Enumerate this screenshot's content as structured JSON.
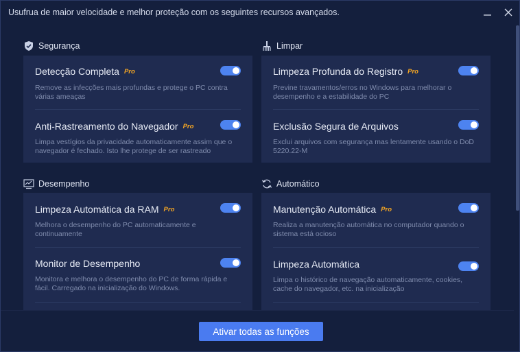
{
  "window": {
    "title": "Usufrua de maior velocidade e melhor proteção com os seguintes recursos avançados."
  },
  "sections": {
    "security": {
      "label": "Segurança",
      "icon": "shield-check-icon",
      "features": [
        {
          "title": "Detecção Completa",
          "pro": "Pro",
          "desc1": "Remove as infecções mais profundas e protege o PC contra",
          "desc2": "várias ameaças",
          "enabled": true
        },
        {
          "title": "Anti-Rastreamento do Navegador",
          "pro": "Pro",
          "desc1": "Limpa vestígios da privacidade automaticamente assim que o",
          "desc2": "navegador é fechado. Isto lhe protege de ser rastreado",
          "enabled": true
        }
      ]
    },
    "clean": {
      "label": "Limpar",
      "icon": "broom-icon",
      "features": [
        {
          "title": "Limpeza Profunda do Registro",
          "pro": "Pro",
          "desc1": "Previne travamentos/erros no Windows para melhorar o",
          "desc2": "desempenho e a estabilidade do PC",
          "enabled": true
        },
        {
          "title": "Exclusão Segura de Arquivos",
          "pro": "",
          "desc1": "Exclui arquivos com segurança mas lentamente usando o DoD",
          "desc2": "5220.22-M",
          "enabled": true
        }
      ]
    },
    "performance": {
      "label": "Desempenho",
      "icon": "monitor-chart-icon",
      "features": [
        {
          "title": "Limpeza Automática da RAM",
          "pro": "Pro",
          "desc1": "Melhora o desempenho do PC automaticamente e",
          "desc2": "continuamente",
          "enabled": true
        },
        {
          "title": "Monitor de Desempenho",
          "pro": "",
          "desc1": "Monitora e melhora o desempenho do PC de forma rápida e",
          "desc2": "fácil. Carregado na inicialização do Windows.",
          "enabled": true
        }
      ]
    },
    "auto": {
      "label": "Automático",
      "icon": "refresh-icon",
      "features": [
        {
          "title": "Manutenção Automática",
          "pro": "Pro",
          "desc1": "Realiza a manutenção automática no computador quando o",
          "desc2": "sistema está ocioso",
          "enabled": true
        },
        {
          "title": "Limpeza Automática",
          "pro": "",
          "desc1": "Limpa o histórico de navegação automaticamente, cookies,",
          "desc2": "cache do navegador, etc. na inicialização",
          "enabled": true
        }
      ]
    }
  },
  "footer": {
    "activate_all_label": "Ativar todas as funções"
  },
  "colors": {
    "background": "#141f3d",
    "panel": "#1f2b50",
    "accent": "#4a7bf0",
    "pro_badge": "#f5a623"
  }
}
